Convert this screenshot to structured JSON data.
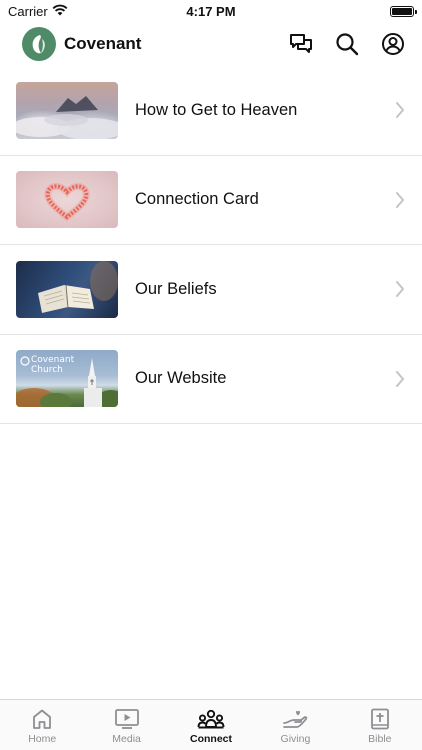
{
  "status_bar": {
    "carrier": "Carrier",
    "time": "4:17 PM"
  },
  "header": {
    "title": "Covenant",
    "icons": [
      "chat-icon",
      "search-icon",
      "profile-icon"
    ]
  },
  "menu": {
    "items": [
      {
        "label": "How to Get to Heaven"
      },
      {
        "label": "Connection Card"
      },
      {
        "label": "Our Beliefs"
      },
      {
        "label": "Our Website",
        "thumb_text_1": "Covenant",
        "thumb_text_2": "Church"
      }
    ]
  },
  "tab_bar": {
    "active": "Connect",
    "tabs": [
      {
        "label": "Home",
        "icon": "home-icon"
      },
      {
        "label": "Media",
        "icon": "media-icon"
      },
      {
        "label": "Connect",
        "icon": "connect-icon"
      },
      {
        "label": "Giving",
        "icon": "giving-icon"
      },
      {
        "label": "Bible",
        "icon": "bible-icon"
      }
    ]
  },
  "colors": {
    "brand": "#4f8b67",
    "tab_inactive": "#8e8e93",
    "tab_active": "#111111",
    "divider": "#e4e4e4"
  }
}
